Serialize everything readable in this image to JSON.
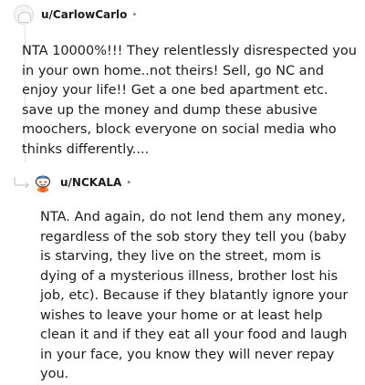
{
  "comments": [
    {
      "username": "u/CarlowCarlo",
      "separator": "•",
      "avatar": "default-snoo-avatar",
      "text": "NTA 10000%!!! They relentlessly disrespected you in your own home..not theirs! Sell, go NC and enjoy your life!! Get a one bed apartment etc. save up the money and dump these abusive moochers, block everyone on social media who thinks differently...."
    },
    {
      "username": "u/NCKALA",
      "separator": "•",
      "avatar": "custom-snoo-avatar",
      "text": "NTA. And again, do not lend them any money, regardless of the sob story they tell you (baby is starving, they live on the street, mom is dying of a mysterious illness, brother lost his job, etc). Because if they blatantly ignore your wishes to leave your home or at least help clean it and if they eat all your food and laugh in your face, you know they will never repay you."
    }
  ],
  "colors": {
    "text": "#1c1c1c",
    "meta": "#7c7c7c",
    "thread_line": "#e6e6e6"
  }
}
